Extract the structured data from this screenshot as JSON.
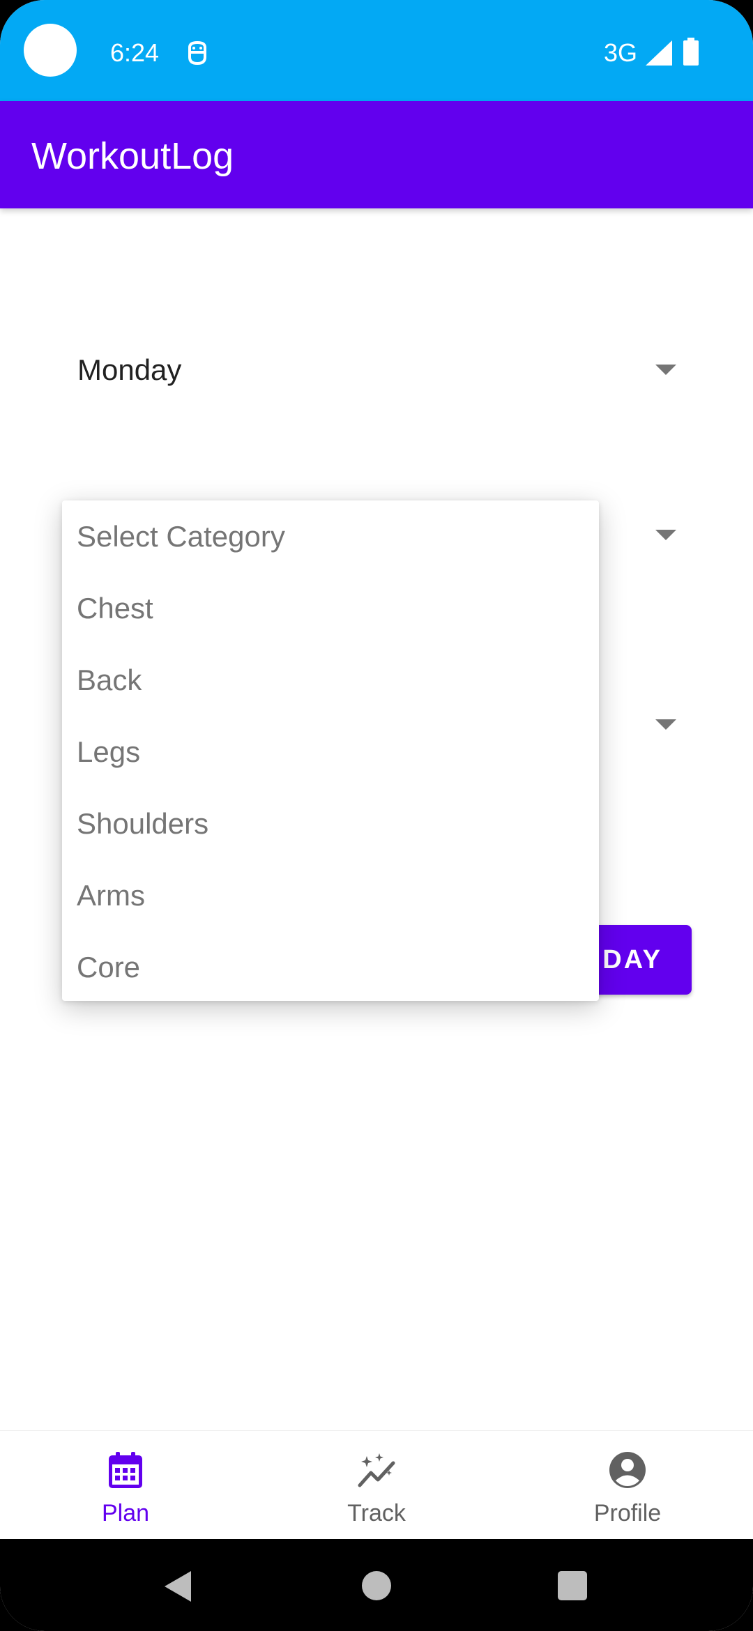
{
  "status_bar": {
    "time": "6:24",
    "network": "3G",
    "icons": [
      "notification-icon",
      "signal-icon",
      "battery-icon"
    ],
    "background_color": "#03A9F4"
  },
  "app_bar": {
    "title": "WorkoutLog",
    "background_color": "#6200EE"
  },
  "form": {
    "day_spinner": {
      "selected": "Monday"
    },
    "add_button": {
      "visible_label": "DAY"
    }
  },
  "category_dropdown": {
    "options": [
      "Select Category",
      "Chest",
      "Back",
      "Legs",
      "Shoulders",
      "Arms",
      "Core"
    ]
  },
  "bottom_nav": {
    "items": [
      {
        "label": "Plan",
        "icon": "calendar-icon",
        "active": true,
        "color": "#6200EE"
      },
      {
        "label": "Track",
        "icon": "track-sparkle-icon",
        "active": false,
        "color": "#616161"
      },
      {
        "label": "Profile",
        "icon": "account-circle-icon",
        "active": false,
        "color": "#616161"
      }
    ]
  },
  "system_nav": {
    "buttons": [
      "back-icon",
      "home-icon",
      "recents-icon"
    ]
  }
}
